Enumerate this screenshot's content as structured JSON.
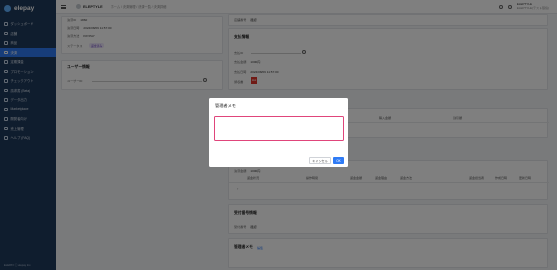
{
  "app": {
    "logo": "elepay",
    "name": "ELEPTYLE",
    "breadcrumb": "ホーム / 決済管理 / 決済一覧 / 決済詳細",
    "user_name": "ELEPTYLE",
    "user_sub": "ELEPTYLE(テスト環境)"
  },
  "sidebar": {
    "items": [
      {
        "label": "ダッシュボード"
      },
      {
        "label": "店舗"
      },
      {
        "label": "商品"
      },
      {
        "label": "決済"
      },
      {
        "label": "定期課金"
      },
      {
        "label": "プロモーション"
      },
      {
        "label": "チェックアウト"
      },
      {
        "label": "請求書 (Beta)"
      },
      {
        "label": "データ出力"
      },
      {
        "label": "Marketplace"
      },
      {
        "label": "開発者向け"
      },
      {
        "label": "売上管理"
      },
      {
        "label": "ヘルプ (FAQ)"
      }
    ],
    "footer": "ELEPAY ⓒ elepay Inc."
  },
  "payment": {
    "status_label": "ステータス",
    "status_value": "返金済み",
    "id_label": "決済ID",
    "id_value": "1860",
    "date_label": "決済日時",
    "date_value": "2024/08/09 11:57:00",
    "method_label": "決済方法",
    "method_value": "PAYPAY"
  },
  "customer": {
    "title": "ユーザー情報",
    "field_label": "ユーザーID"
  },
  "right_top": {
    "label": "店舗番号",
    "value": "確認"
  },
  "settlement": {
    "title": "支払情報",
    "no_label": "支払ID",
    "amount_label": "支払金額",
    "amount_value": "1000円",
    "date_label": "支払日時",
    "date_value": "2024/08/09 11:57:00",
    "receipt_label": "領収書",
    "pdf_label": "PDF"
  },
  "table1": {
    "headers": [
      "購入金額",
      "割引額"
    ]
  },
  "table2": {
    "summary_label": "決済金額",
    "summary_value": "1000円",
    "headers": [
      "返金状況",
      "操作時間",
      "返金金額",
      "返金理由",
      "返金方法",
      "返金担当者",
      "作成日時",
      "更新日時"
    ]
  },
  "shipping": {
    "title": "受付番号情報",
    "row_label": "受付番号",
    "row_value": "確認"
  },
  "memo": {
    "title": "管理者メモ",
    "edit_label": "編集"
  },
  "modal": {
    "title": "管理者メモ",
    "textarea_value": "",
    "cancel_label": "キャンセル",
    "ok_label": "OK"
  },
  "colors": {
    "sidebar": "#1f3a5c",
    "primary": "#2f7bf5",
    "textarea_border": "#e0457b"
  }
}
